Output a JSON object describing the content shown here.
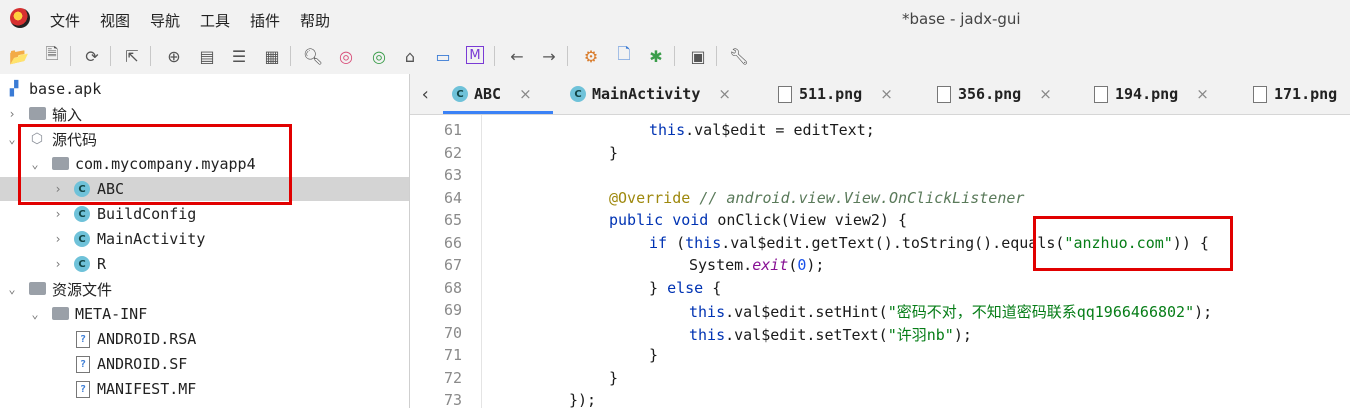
{
  "window": {
    "title": "*base - jadx-gui"
  },
  "menu": [
    "文件",
    "视图",
    "导航",
    "工具",
    "插件",
    "帮助"
  ],
  "toolbar": {
    "icons": [
      "open-icon",
      "add-files-icon",
      "refresh-icon",
      "export-icon",
      "sync-icon",
      "folder-tree-icon",
      "list-icon",
      "grid-icon",
      "search-icon",
      "search-class-icon",
      "search-usage-icon",
      "home-icon",
      "window-icon",
      "m-icon",
      "back-icon",
      "forward-icon",
      "deobfuscation-icon",
      "decompile-icon",
      "debug-icon",
      "log-icon",
      "settings-icon"
    ]
  },
  "tree": {
    "root": "base.apk",
    "input": "输入",
    "source": "源代码",
    "package": "com.mycompany.myapp4",
    "classes": [
      "ABC",
      "BuildConfig",
      "MainActivity",
      "R"
    ],
    "resources": "资源文件",
    "metainf": "META-INF",
    "files": [
      "ANDROID.RSA",
      "ANDROID.SF",
      "MANIFEST.MF"
    ],
    "class_icon_letter": "C"
  },
  "tabs": [
    {
      "label": "ABC",
      "type": "class"
    },
    {
      "label": "MainActivity",
      "type": "class"
    },
    {
      "label": "511.png",
      "type": "file"
    },
    {
      "label": "356.png",
      "type": "file"
    },
    {
      "label": "194.png",
      "type": "file"
    },
    {
      "label": "171.png",
      "type": "file"
    }
  ],
  "code": {
    "line_numbers": [
      "61",
      "62",
      "63",
      "64",
      "65",
      "66",
      "67",
      "68",
      "69",
      "70",
      "71",
      "72",
      "73"
    ],
    "l61_this": "this",
    "l61_rest": ".val$edit = editText;",
    "l62": "}",
    "l64_ann": "@Override",
    "l64_cmt": "// android.view.View.OnClickListener",
    "l65_kw": "public void",
    "l65_rest": " onClick(View view2) {",
    "l66_if": "if",
    "l66_a": " (",
    "l66_this": "this",
    "l66_b": ".val$edit.getText().toString().equals(",
    "l66_str": "\"anzhuo.com\"",
    "l66_c": ")) {",
    "l67_a": "System.",
    "l67_b": "exit",
    "l67_c": "(",
    "l67_num": "0",
    "l67_d": ");",
    "l68_a": "} ",
    "l68_else": "else",
    "l68_b": " {",
    "l69_this": "this",
    "l69_a": ".val$edit.setHint(",
    "l69_str": "\"密码不对，不知道密码联系qq1966466802\"",
    "l69_b": ");",
    "l70_this": "this",
    "l70_a": ".val$edit.setText(",
    "l70_str": "\"许羽nb\"",
    "l70_b": ");",
    "l71": "}",
    "l72": "}",
    "l73": "});"
  },
  "colors": {
    "highlight_box": "#e10000",
    "selected_row": "#d4d4d4",
    "active_tab_line": "#3b82f6"
  }
}
